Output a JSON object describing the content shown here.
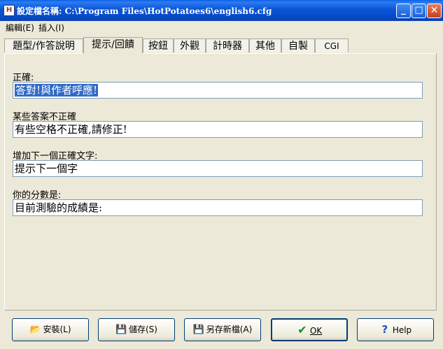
{
  "window": {
    "title": "設定檔名稱: C:\\Program Files\\HotPotatoes6\\english6.cfg",
    "app_icon": "H",
    "min": "_",
    "max": "□",
    "close": "✕"
  },
  "menu": [
    {
      "label": "編輯(E)"
    },
    {
      "label": "插入(I)"
    }
  ],
  "tabs": [
    {
      "label": "題型/作答說明"
    },
    {
      "label": "提示/回饋"
    },
    {
      "label": "按鈕"
    },
    {
      "label": "外觀"
    },
    {
      "label": "計時器"
    },
    {
      "label": "其他"
    },
    {
      "label": "自製"
    },
    {
      "label": "CGI"
    }
  ],
  "fields": [
    {
      "label": "正確:",
      "value": "答對!與作者呼應!"
    },
    {
      "label": "某些答案不正確",
      "value": "有些空格不正確,請修正!"
    },
    {
      "label": "增加下一個正確文字:",
      "value": "提示下一個字"
    },
    {
      "label": "你的分數是:",
      "value": "目前測驗的成績是:"
    }
  ],
  "buttons": {
    "install": {
      "label": "安裝(L)",
      "icon": "📂"
    },
    "save": {
      "label": "儲存(S)",
      "icon": "💾"
    },
    "save_as": {
      "label": "另存新檔(A)",
      "icon": "💾"
    },
    "ok": {
      "label": "OK",
      "icon": "✔"
    },
    "help": {
      "label": "Help",
      "icon": "?"
    }
  },
  "colors": {
    "titlebar": "#0a5fe6",
    "selection": "#316ac5",
    "ok_check": "#1b8a1b",
    "help_q": "#1f4fd0"
  }
}
